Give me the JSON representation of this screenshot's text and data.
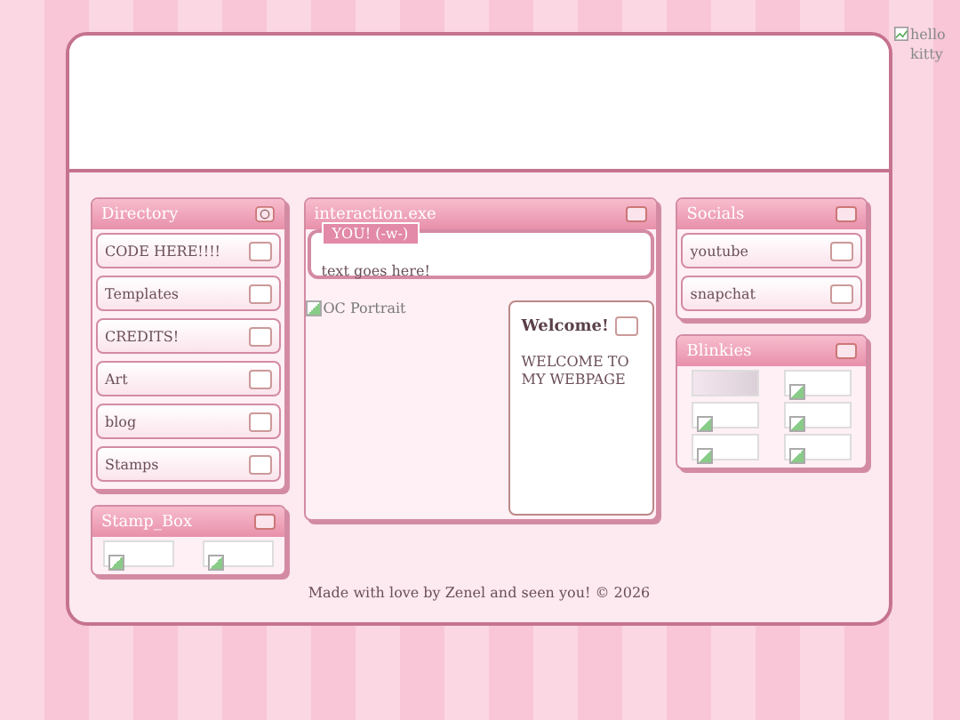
{
  "header_image": {
    "alt": "hello kitty"
  },
  "directory": {
    "title": "Directory",
    "items": [
      "CODE HERE!!!!",
      "Templates",
      "CREDITS!",
      "Art",
      "blog",
      "Stamps"
    ]
  },
  "stamp_box": {
    "title": "Stamp_Box"
  },
  "interaction": {
    "title": "interaction.exe",
    "tag": "YOU! (-w-)",
    "message": "text goes here!"
  },
  "portrait": {
    "alt": "OC Portrait"
  },
  "welcome": {
    "title": "Welcome!",
    "body": "WELCOME TO MY WEBPAGE"
  },
  "socials": {
    "title": "Socials",
    "items": [
      "youtube",
      "snapchat"
    ]
  },
  "blinkies": {
    "title": "Blinkies"
  },
  "footer": "Made with love by Zenel and seen you! © 2026"
}
